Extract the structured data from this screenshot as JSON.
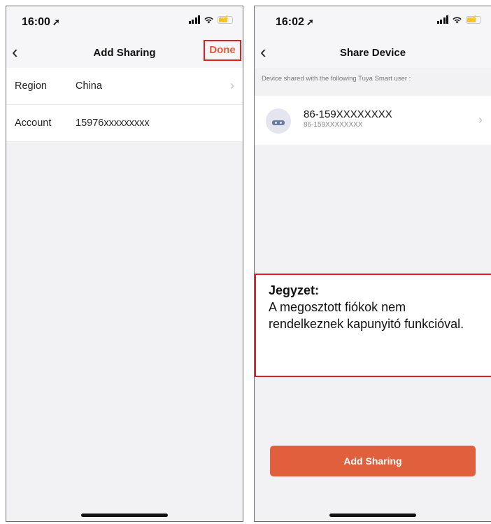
{
  "left_screen": {
    "status": {
      "time": "16:00",
      "location_icon": "location-arrow-icon"
    },
    "nav": {
      "back": "‹",
      "title": "Add Sharing",
      "done": "Done"
    },
    "fields": [
      {
        "label": "Region",
        "value": "China",
        "chevron": "›"
      },
      {
        "label": "Account",
        "value": "15976xxxxxxxxx"
      }
    ]
  },
  "right_screen": {
    "status": {
      "time": "16:02",
      "location_icon": "location-arrow-icon"
    },
    "nav": {
      "back": "‹",
      "title": "Share Device"
    },
    "hint": "Device shared with the following Tuya Smart user :",
    "user": {
      "name": "86-159XXXXXXXX",
      "sub": "86-159XXXXXXXX",
      "chevron": "›"
    },
    "note": {
      "title": "Jegyzet:",
      "body": "A megosztott fiókok nem rendelkeznek kapunyitó funkcióval."
    },
    "add_button": "Add Sharing"
  },
  "colors": {
    "accent": "#e0603d",
    "highlight_border": "#e02020",
    "background": "#f2f2f4"
  }
}
